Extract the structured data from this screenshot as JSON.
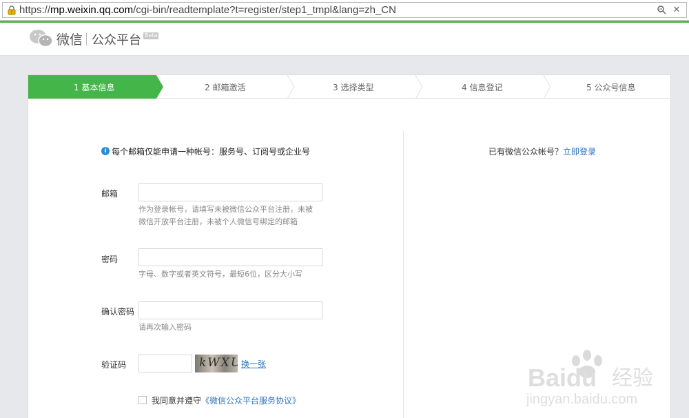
{
  "browser": {
    "url_scheme": "https://",
    "url_host": "mp.weixin.qq.com",
    "url_path": "/cgi-bin/readtemplate?t=register/step1_tmpl&lang=zh_CN"
  },
  "header": {
    "brand": "微信",
    "product": "公众平台",
    "beta": "Beta"
  },
  "steps": [
    {
      "label": "1 基本信息",
      "active": true
    },
    {
      "label": "2 邮箱激活",
      "active": false
    },
    {
      "label": "3 选择类型",
      "active": false
    },
    {
      "label": "4 信息登记",
      "active": false
    },
    {
      "label": "5 公众号信息",
      "active": false
    }
  ],
  "form": {
    "notice": "每个邮箱仅能申请一种帐号：服务号、订阅号或企业号",
    "email": {
      "label": "邮箱",
      "tip": "作为登录帐号，请填写未被微信公众平台注册，未被微信开放平台注册，未被个人微信号绑定的邮箱"
    },
    "password": {
      "label": "密码",
      "tip": "字母、数字或者英文符号，最短6位，区分大小写"
    },
    "confirm": {
      "label": "确认密码",
      "tip": "请再次输入密码"
    },
    "captcha": {
      "label": "验证码",
      "image_text": "kWXU",
      "refresh": "换一张"
    },
    "agree": {
      "prefix": "我同意并遵守",
      "link": "《微信公众平台服务协议》"
    }
  },
  "aside": {
    "text": "已有微信公众帐号？",
    "link": "立即登录"
  },
  "watermark": {
    "brand": "Baidu",
    "cn": "经验",
    "site": "jingyan.baidu.com"
  },
  "colors": {
    "accent": "#44b549",
    "link": "#2b74c2",
    "info": "#2b8bd6"
  }
}
